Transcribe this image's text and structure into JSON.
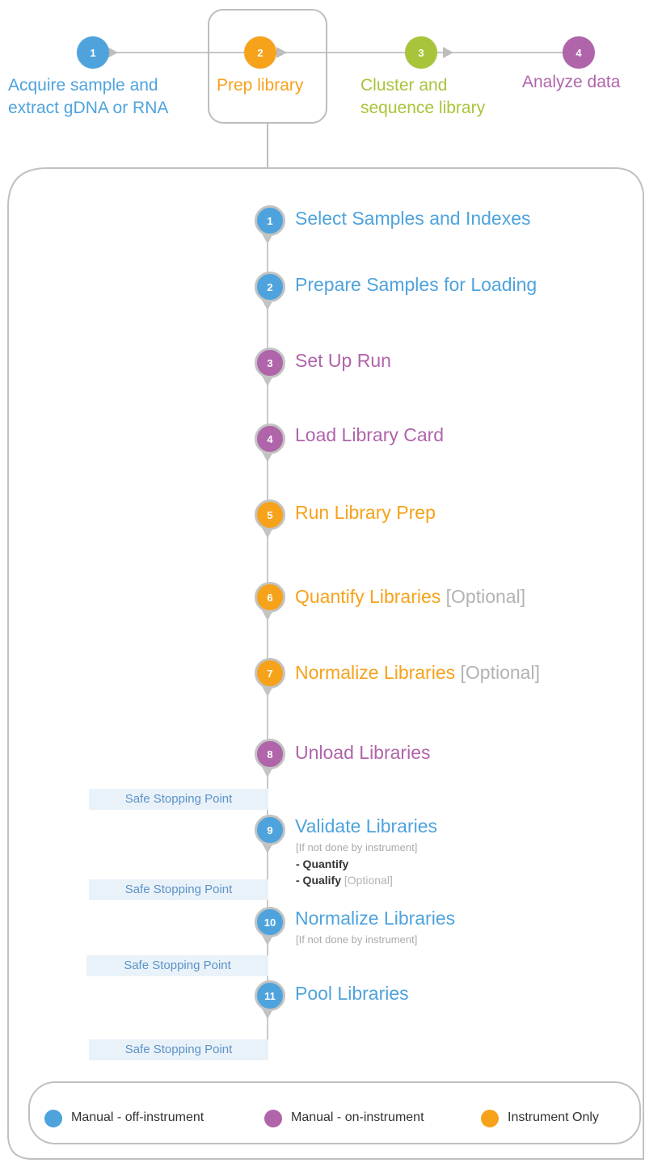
{
  "colors": {
    "blue": "#4ea3dd",
    "orange": "#f6a21b",
    "green": "#a8c43a",
    "purple": "#b064aa",
    "grey": "#a9a9a9",
    "safe_bg": "#eaf2f9"
  },
  "top_steps": [
    {
      "num": "1",
      "line1": "Acquire sample and",
      "line2": "extract gDNA or RNA",
      "color": "blue"
    },
    {
      "num": "2",
      "line1": "Prep library",
      "line2": "",
      "color": "orange"
    },
    {
      "num": "3",
      "line1": "Cluster and",
      "line2": "sequence library",
      "color": "green"
    },
    {
      "num": "4",
      "line1": "Analyze data",
      "line2": "",
      "color": "purple"
    }
  ],
  "steps": [
    {
      "num": "1",
      "label": "Select Samples and Indexes",
      "optional": "",
      "color": "blue"
    },
    {
      "num": "2",
      "label": "Prepare Samples for Loading",
      "optional": "",
      "color": "blue"
    },
    {
      "num": "3",
      "label": "Set Up Run",
      "optional": "",
      "color": "purple"
    },
    {
      "num": "4",
      "label": "Load Library Card",
      "optional": "",
      "color": "purple"
    },
    {
      "num": "5",
      "label": "Run Library Prep",
      "optional": "",
      "color": "orange"
    },
    {
      "num": "6",
      "label": "Quantify Libraries",
      "optional": "[Optional]",
      "color": "orange"
    },
    {
      "num": "7",
      "label": "Normalize Libraries",
      "optional": "[Optional]",
      "color": "orange"
    },
    {
      "num": "8",
      "label": "Unload Libraries",
      "optional": "",
      "color": "purple"
    },
    {
      "num": "9",
      "label": "Validate Libraries",
      "optional": "",
      "color": "blue"
    },
    {
      "num": "10",
      "label": "Normalize Libraries",
      "optional": "",
      "color": "blue"
    },
    {
      "num": "11",
      "label": "Pool Libraries",
      "optional": "",
      "color": "blue"
    }
  ],
  "step9_note": "[If not done by instrument]",
  "step9_items": [
    "- Quantify",
    "- Qualify"
  ],
  "step9_qualify_optional": "[Optional]",
  "step10_note": "[If not done by instrument]",
  "safe_stopping_label": "Safe Stopping Point",
  "legend": [
    {
      "label": "Manual - off-instrument",
      "color": "blue"
    },
    {
      "label": "Manual - on-instrument",
      "color": "purple"
    },
    {
      "label": "Instrument Only",
      "color": "orange"
    }
  ]
}
